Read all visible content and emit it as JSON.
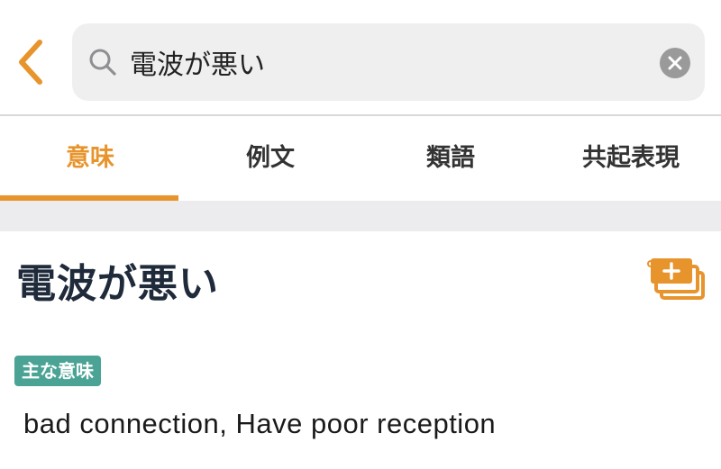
{
  "search": {
    "query": "電波が悪い"
  },
  "tabs": [
    {
      "label": "意味",
      "active": true
    },
    {
      "label": "例文",
      "active": false
    },
    {
      "label": "類語",
      "active": false
    },
    {
      "label": "共起表現",
      "active": false
    }
  ],
  "entry": {
    "title": "電波が悪い",
    "badge": "主な意味",
    "meaning": "bad connection, Have poor reception"
  },
  "colors": {
    "accent": "#e8942c",
    "badge": "#4aa394",
    "title": "#1f2a3a"
  },
  "icons": {
    "back": "chevron-left-icon",
    "search": "magnifier-icon",
    "clear": "clear-icon",
    "wordbook": "add-to-wordbook-icon"
  }
}
